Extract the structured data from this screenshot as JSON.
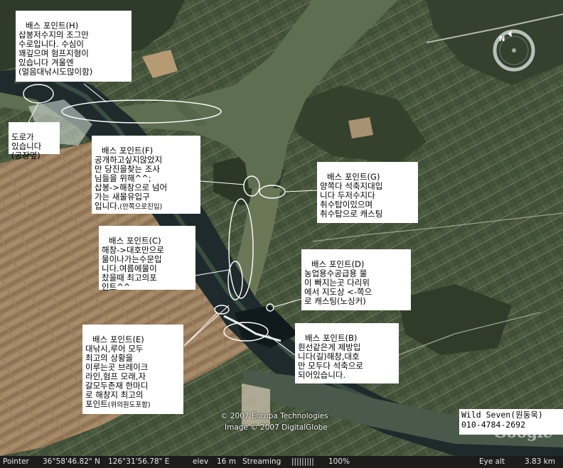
{
  "notes": {
    "h": {
      "title": "배스 포인트(H)",
      "body": "삽봉저수지의 조그만\n수로입니다. 수심이\n꽤깊으며 험프지형이\n있습니다 겨울엔\n(얼음대낚시도많이함)"
    },
    "road": {
      "body": "도로가\n있습니다\n(공장옆)"
    },
    "f": {
      "title": "배스 포인트(F)",
      "body": "공개하고싶지않았지\n만 당진을찾는 조사\n님들을 위해^^;\n삽봉->해창으로 넘어\n가는 새물유입구\n입니다.",
      "note": "(안쪽으로진입)"
    },
    "g": {
      "title": "배스 포인트(G)",
      "body": "양쪽다 석축지대입\n니다 두저수지다\n취수탑이있으며\n취수탑으로 캐스팅"
    },
    "c": {
      "title": "배스 포인트(C)",
      "body": "해창->대호만으로\n물이나가는수문입\n니다.여름에물이\n찼을때 최고의포\n인트^^"
    },
    "d": {
      "title": "배스 포인트(D)",
      "body": "농업용수공급용 물\n이 빠지는곳 다리위\n에서 지도상 <-쪽으\n로 캐스팅(노싱커)"
    },
    "e": {
      "title": "배스 포인트(E)",
      "body": "대낚시,루어 모두\n최고의 상황을\n이루는곳 브레이크\n라인,험프 모래,자\n갈모두존재 한마디\n로 해창지 최고의\n포인트",
      "note": "(위의원도포함)"
    },
    "b": {
      "title": "배스 포인트(B)",
      "body": "흰선같은게 제방입\n니다(길)해창,대호\n만 모두다 석축으로\n되어있습니다."
    }
  },
  "credits": {
    "line1": "© 2007 Europa Technologies",
    "line2": "Image © 2007 DigitalGlobe",
    "logo": "Google"
  },
  "author": {
    "name": "Wild Seven(원동욱)",
    "phone": "010-4784-2692"
  },
  "status": {
    "pointer_label": "Pointer",
    "lat": "36°58'46.82\" N",
    "lon": "126°31'56.78\" E",
    "elev_label": "elev",
    "elev": "16 m",
    "streaming_label": "Streaming",
    "streaming_bar": "|||||||||",
    "streaming_pct": "100%",
    "eye_label": "Eye alt",
    "eye_alt": "3.83 km"
  },
  "compass": {
    "north_label": "N"
  },
  "colors": {
    "water": "#5f6f52",
    "land_dark": "#33402c",
    "fields": "#4c5a3e",
    "farmland_brown": "#9b7e5e",
    "annotation_stroke": "#ffffff"
  }
}
